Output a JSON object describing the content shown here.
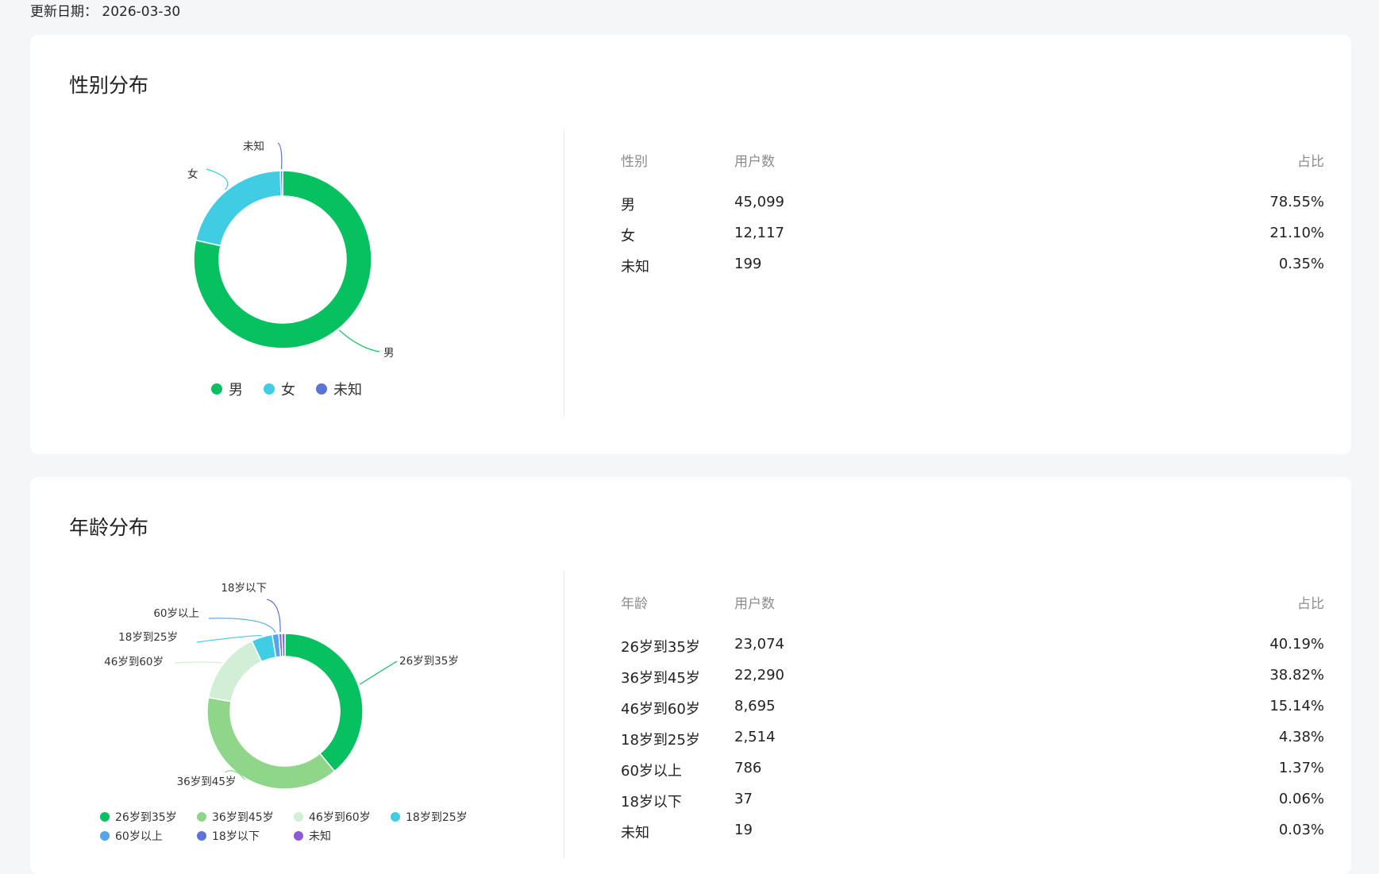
{
  "header": {
    "update_label": "更新日期：",
    "update_date": "2026-03-30"
  },
  "gender": {
    "title": "性别分布",
    "columns": [
      "性别",
      "用户数",
      "占比"
    ],
    "rows": [
      {
        "name": "男",
        "count": "45,099",
        "pct": "78.55%"
      },
      {
        "name": "女",
        "count": "12,117",
        "pct": "21.10%"
      },
      {
        "name": "未知",
        "count": "199",
        "pct": "0.35%"
      }
    ]
  },
  "age": {
    "title": "年龄分布",
    "columns": [
      "年龄",
      "用户数",
      "占比"
    ],
    "rows": [
      {
        "name": "26岁到35岁",
        "count": "23,074",
        "pct": "40.19%"
      },
      {
        "name": "36岁到45岁",
        "count": "22,290",
        "pct": "38.82%"
      },
      {
        "name": "46岁到60岁",
        "count": "8,695",
        "pct": "15.14%"
      },
      {
        "name": "18岁到25岁",
        "count": "2,514",
        "pct": "4.38%"
      },
      {
        "name": "60岁以上",
        "count": "786",
        "pct": "1.37%"
      },
      {
        "name": "18岁以下",
        "count": "37",
        "pct": "0.06%"
      },
      {
        "name": "未知",
        "count": "19",
        "pct": "0.03%"
      }
    ]
  },
  "chart_data": [
    {
      "type": "pie",
      "title": "性别分布",
      "categories": [
        "男",
        "女",
        "未知"
      ],
      "values": [
        45099,
        12117,
        199
      ],
      "colors": [
        "#07c160",
        "#40cde3",
        "#5b74d6"
      ],
      "legend": "bottom"
    },
    {
      "type": "pie",
      "title": "年龄分布",
      "categories": [
        "26岁到35岁",
        "36岁到45岁",
        "46岁到60岁",
        "18岁到25岁",
        "60岁以上",
        "18岁以下",
        "未知"
      ],
      "values": [
        23074,
        22290,
        8695,
        2514,
        786,
        37,
        19
      ],
      "colors": [
        "#07c160",
        "#8fd68b",
        "#d0efd4",
        "#40cde3",
        "#55a4ec",
        "#5b74d6",
        "#8f5ad6"
      ],
      "legend": "bottom"
    }
  ]
}
